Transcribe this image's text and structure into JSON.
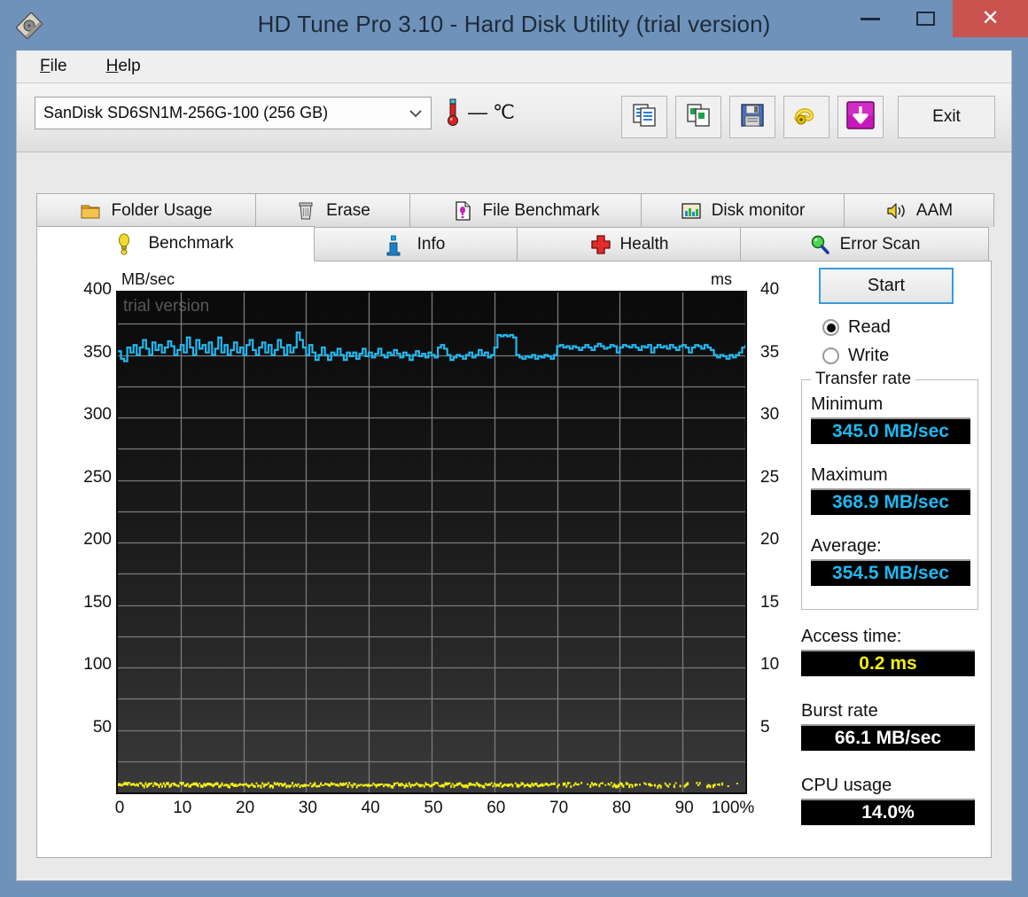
{
  "window": {
    "title": "HD Tune Pro 3.10 - Hard Disk Utility (trial version)",
    "app_icon": "hard-disk-icon",
    "controls": {
      "minimize": "–",
      "maximize": "☐",
      "close": "✕"
    },
    "frame_color": "#6f92bb",
    "close_color": "#c9534f"
  },
  "menubar": {
    "items": [
      {
        "label": "File",
        "accel": "F",
        "rest": "ile"
      },
      {
        "label": "Help",
        "accel": "H",
        "rest": "elp"
      }
    ]
  },
  "toolbar": {
    "drive": {
      "value": "SanDisk SD6SN1M-256G-100 (256 GB)",
      "arrow": "˅"
    },
    "temperature": {
      "icon": "thermometer-icon",
      "value": "— ℃"
    },
    "buttons": [
      {
        "name": "copy-text-icon",
        "label": ""
      },
      {
        "name": "copy-image-icon",
        "label": ""
      },
      {
        "name": "save-icon",
        "label": ""
      },
      {
        "name": "measuring-tape-icon",
        "label": ""
      },
      {
        "name": "download-arrow-icon",
        "label": ""
      }
    ],
    "exit_label": "Exit"
  },
  "tabs": {
    "row_top": [
      {
        "label": "Folder Usage",
        "icon": "folder-icon",
        "active": false
      },
      {
        "label": "Erase",
        "icon": "trash-icon",
        "active": false
      },
      {
        "label": "File Benchmark",
        "icon": "file-benchmark-icon",
        "active": false
      },
      {
        "label": "Disk monitor",
        "icon": "bar-chart-icon",
        "active": false
      },
      {
        "label": "AAM",
        "icon": "speaker-icon",
        "active": false
      }
    ],
    "row_bottom": [
      {
        "label": "Benchmark",
        "icon": "lightbulb-icon",
        "active": true
      },
      {
        "label": "Info",
        "icon": "info-icon",
        "active": false
      },
      {
        "label": "Health",
        "icon": "red-cross-icon",
        "active": false
      },
      {
        "label": "Error Scan",
        "icon": "magnifier-icon",
        "active": false
      }
    ]
  },
  "benchmark": {
    "start_label": "Start",
    "mode_options": [
      {
        "label": "Read",
        "selected": true
      },
      {
        "label": "Write",
        "selected": false
      }
    ],
    "transfer_rate": {
      "group_title": "Transfer rate",
      "minimum_label": "Minimum",
      "minimum_value": "345.0 MB/sec",
      "maximum_label": "Maximum",
      "maximum_value": "368.9 MB/sec",
      "average_label": "Average:",
      "average_value": "354.5 MB/sec"
    },
    "access_time_label": "Access time:",
    "access_time_value": "0.2 ms",
    "burst_rate_label": "Burst rate",
    "burst_rate_value": "66.1 MB/sec",
    "cpu_usage_label": "CPU usage",
    "cpu_usage_value": "14.0%",
    "watermark": "trial version",
    "value_colors": {
      "transfer": "#22b7ee",
      "access_time": "#f2ee14",
      "burst": "#ffffff",
      "cpu": "#ffffff"
    }
  },
  "chart_data": {
    "type": "line",
    "title": "",
    "xlabel": "",
    "ylabel": "MB/sec",
    "y2label": "ms",
    "xlim": [
      0,
      100
    ],
    "ylim": [
      0,
      400
    ],
    "y2lim": [
      0,
      40
    ],
    "xticks": [
      "0",
      "10",
      "20",
      "30",
      "40",
      "50",
      "60",
      "70",
      "80",
      "90",
      "100%"
    ],
    "xtick_values": [
      0,
      10,
      20,
      30,
      40,
      50,
      60,
      70,
      80,
      90,
      100
    ],
    "yticks": [
      "50",
      "100",
      "150",
      "200",
      "250",
      "300",
      "350",
      "400"
    ],
    "ytick_values": [
      50,
      100,
      150,
      200,
      250,
      300,
      350,
      400
    ],
    "y2ticks": [
      "5",
      "10",
      "15",
      "20",
      "25",
      "30",
      "35",
      "40"
    ],
    "y2tick_values": [
      5,
      10,
      15,
      20,
      25,
      30,
      35,
      40
    ],
    "grid": true,
    "legend": "none",
    "plot_bg_top": "#0a0a0a",
    "plot_bg_bottom": "#3a3a3a",
    "series": [
      {
        "name": "Transfer rate",
        "color": "#22b7ee",
        "axis": "left",
        "units": "MB/sec",
        "x": [
          0,
          0.5,
          1,
          1.5,
          2,
          2.5,
          3,
          3.5,
          4,
          4.5,
          5,
          5.5,
          6,
          6.5,
          7,
          7.5,
          8,
          8.5,
          9,
          9.5,
          10,
          10.5,
          11,
          11.5,
          12,
          12.5,
          13,
          13.5,
          14,
          14.5,
          15,
          15.5,
          16,
          16.5,
          17,
          17.5,
          18,
          18.5,
          19,
          19.5,
          20,
          20.5,
          21,
          21.5,
          22,
          22.5,
          23,
          23.5,
          24,
          24.5,
          25,
          25.5,
          26,
          26.5,
          27,
          27.5,
          28,
          28.5,
          29,
          29.5,
          30,
          30.5,
          31,
          31.5,
          32,
          32.5,
          33,
          33.5,
          34,
          34.5,
          35,
          35.5,
          36,
          36.5,
          37,
          37.5,
          38,
          38.5,
          39,
          39.5,
          40,
          40.5,
          41,
          41.5,
          42,
          42.5,
          43,
          43.5,
          44,
          44.5,
          45,
          45.5,
          46,
          46.5,
          47,
          47.5,
          48,
          48.5,
          49,
          49.5,
          50,
          50.5,
          51,
          51.5,
          52,
          52.5,
          53,
          53.5,
          54,
          54.5,
          55,
          55.5,
          56,
          56.5,
          57,
          57.5,
          58,
          58.5,
          59,
          59.5,
          60,
          60.5,
          61,
          61.5,
          62,
          62.5,
          63,
          63.5,
          64,
          64.5,
          65,
          65.5,
          66,
          66.5,
          67,
          67.5,
          68,
          68.5,
          69,
          69.5,
          70,
          70.5,
          71,
          71.5,
          72,
          72.5,
          73,
          73.5,
          74,
          74.5,
          75,
          75.5,
          76,
          76.5,
          77,
          77.5,
          78,
          78.5,
          79,
          79.5,
          80,
          80.5,
          81,
          81.5,
          82,
          82.5,
          83,
          83.5,
          84,
          84.5,
          85,
          85.5,
          86,
          86.5,
          87,
          87.5,
          88,
          88.5,
          89,
          89.5,
          90,
          90.5,
          91,
          91.5,
          92,
          92.5,
          93,
          93.5,
          94,
          94.5,
          95,
          95.5,
          96,
          96.5,
          97,
          97.5,
          98,
          98.5,
          99,
          99.5,
          100
        ],
        "y": [
          353,
          347,
          345,
          356,
          352,
          358,
          350,
          356,
          362,
          355,
          350,
          360,
          354,
          358,
          352,
          356,
          361,
          357,
          350,
          354,
          358,
          352,
          364,
          356,
          350,
          362,
          355,
          358,
          352,
          360,
          350,
          355,
          364,
          352,
          358,
          350,
          354,
          360,
          352,
          356,
          350,
          358,
          362,
          354,
          350,
          356,
          360,
          352,
          358,
          350,
          354,
          362,
          356,
          350,
          358,
          352,
          356,
          368,
          362,
          356,
          350,
          358,
          352,
          346,
          350,
          356,
          350,
          346,
          352,
          350,
          355,
          350,
          346,
          352,
          349,
          352,
          347,
          351,
          355,
          349,
          352,
          348,
          351,
          355,
          350,
          348,
          352,
          350,
          354,
          351,
          348,
          352,
          350,
          346,
          350,
          353,
          349,
          351,
          348,
          352,
          350,
          348,
          356,
          358,
          355,
          350,
          346,
          348,
          350,
          349,
          347,
          350,
          352,
          348,
          350,
          354,
          350,
          352,
          348,
          350,
          356,
          366,
          365,
          366,
          365,
          366,
          364,
          350,
          348,
          347,
          349,
          348,
          350,
          347,
          349,
          348,
          350,
          349,
          347,
          350,
          357,
          358,
          356,
          357,
          355,
          357,
          356,
          354,
          356,
          358,
          356,
          354,
          357,
          359,
          357,
          355,
          356,
          358,
          357,
          352,
          356,
          358,
          357,
          356,
          358,
          356,
          354,
          357,
          356,
          358,
          352,
          356,
          358,
          356,
          357,
          355,
          358,
          356,
          354,
          357,
          358,
          356,
          352,
          356,
          358,
          357,
          355,
          358,
          356,
          354,
          350,
          348,
          350,
          349,
          347,
          350,
          348,
          350,
          352,
          356,
          358,
          357,
          356,
          358
        ]
      },
      {
        "name": "Access time",
        "color": "#f2ee14",
        "axis": "right",
        "units": "ms",
        "description": "Scatter of access-time samples clustered near 0.2 ms along the bottom of the plot"
      }
    ]
  }
}
